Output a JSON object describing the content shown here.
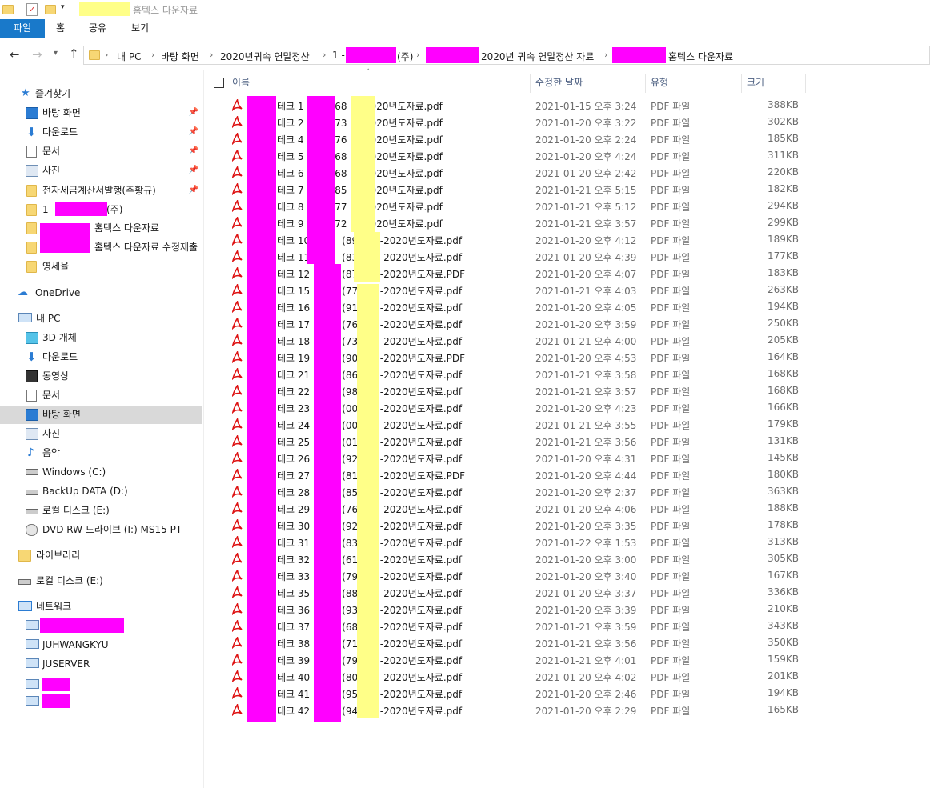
{
  "window": {
    "title": "홈텍스 다운자료"
  },
  "ribbon": {
    "tabs": [
      "파일",
      "홈",
      "공유",
      "보기"
    ]
  },
  "address": {
    "crumbs": [
      "내 PC",
      "바탕 화면",
      "2020년귀속 연말정산",
      "1 -",
      "(주)",
      "2020년 귀속 연말정산 자료",
      "홈텍스 다운자료"
    ]
  },
  "sidebar": {
    "quick_access": "즐겨찾기",
    "quick_items": [
      "바탕 화면",
      "다운로드",
      "문서",
      "사진",
      "전자세금계산서발행(주황규)",
      "1 -",
      "(주)",
      "홈텍스 다운자료",
      "홈텍스 다운자료 수정제출",
      "영세율"
    ],
    "onedrive": "OneDrive",
    "this_pc": "내 PC",
    "pc_items": [
      "3D 개체",
      "다운로드",
      "동영상",
      "문서",
      "바탕 화면",
      "사진",
      "음악",
      "Windows (C:)",
      "BackUp DATA (D:)",
      "로컬 디스크 (E:)",
      "DVD RW 드라이브 (I:) MS15 PT"
    ],
    "libraries": "라이브러리",
    "local_disk": "로컬 디스크 (E:)",
    "network": "네트워크",
    "network_items": [
      "JUHWANGKYU",
      "JUSERVER"
    ]
  },
  "columns": {
    "name": "이름",
    "date": "수정한 날짜",
    "type": "유형",
    "size": "크기"
  },
  "files": [
    {
      "n": "테크 1",
      "p": "(68",
      "s": "-2020년도자료.pdf",
      "d": "2021-01-15 오후 3:24",
      "t": "PDF 파일",
      "z": "388KB"
    },
    {
      "n": "테크 2",
      "p": "(73",
      "s": "-2020년도자료.pdf",
      "d": "2021-01-20 오후 3:22",
      "t": "PDF 파일",
      "z": "302KB"
    },
    {
      "n": "테크 4",
      "p": "(76",
      "s": "-2020년도자료.pdf",
      "d": "2021-01-20 오후 2:24",
      "t": "PDF 파일",
      "z": "185KB"
    },
    {
      "n": "테크 5",
      "p": "(68",
      "s": "-2020년도자료.pdf",
      "d": "2021-01-20 오후 4:24",
      "t": "PDF 파일",
      "z": "311KB"
    },
    {
      "n": "테크 6",
      "p": "(68",
      "s": "-2020년도자료.pdf",
      "d": "2021-01-20 오후 2:42",
      "t": "PDF 파일",
      "z": "220KB"
    },
    {
      "n": "테크 7",
      "p": "(85",
      "s": "-2020년도자료.pdf",
      "d": "2021-01-21 오후 5:15",
      "t": "PDF 파일",
      "z": "182KB"
    },
    {
      "n": "테크 8",
      "p": "(77",
      "s": "-2020년도자료.pdf",
      "d": "2021-01-21 오후 5:12",
      "t": "PDF 파일",
      "z": "294KB"
    },
    {
      "n": "테크 9",
      "p": "(72",
      "s": "-2020년도자료.pdf",
      "d": "2021-01-21 오후 3:57",
      "t": "PDF 파일",
      "z": "299KB"
    },
    {
      "n": "테크 10",
      "p": "(89",
      "s": ")-2020년도자료.pdf",
      "d": "2021-01-20 오후 4:12",
      "t": "PDF 파일",
      "z": "189KB"
    },
    {
      "n": "테크 11",
      "p": "(83",
      "s": ")-2020년도자료.pdf",
      "d": "2021-01-20 오후 4:39",
      "t": "PDF 파일",
      "z": "177KB"
    },
    {
      "n": "테크 12",
      "p": "(87",
      "s": ")-2020년도자료.PDF",
      "d": "2021-01-20 오후 4:07",
      "t": "PDF 파일",
      "z": "183KB"
    },
    {
      "n": "테크 15",
      "p": "(77",
      "s": ")-2020년도자료.pdf",
      "d": "2021-01-21 오후 4:03",
      "t": "PDF 파일",
      "z": "263KB"
    },
    {
      "n": "테크 16",
      "p": "(91",
      "s": ")-2020년도자료.pdf",
      "d": "2021-01-20 오후 4:05",
      "t": "PDF 파일",
      "z": "194KB"
    },
    {
      "n": "테크 17",
      "p": "(76",
      "s": ")-2020년도자료.pdf",
      "d": "2021-01-20 오후 3:59",
      "t": "PDF 파일",
      "z": "250KB"
    },
    {
      "n": "테크 18",
      "p": "(73",
      "s": ")-2020년도자료.pdf",
      "d": "2021-01-21 오후 4:00",
      "t": "PDF 파일",
      "z": "205KB"
    },
    {
      "n": "테크 19",
      "p": "(90",
      "s": ")-2020년도자료.PDF",
      "d": "2021-01-20 오후 4:53",
      "t": "PDF 파일",
      "z": "164KB"
    },
    {
      "n": "테크 21",
      "p": "(86",
      "s": ")-2020년도자료.pdf",
      "d": "2021-01-21 오후 3:58",
      "t": "PDF 파일",
      "z": "168KB"
    },
    {
      "n": "테크 22",
      "p": "(98",
      "s": ")-2020년도자료.pdf",
      "d": "2021-01-21 오후 3:57",
      "t": "PDF 파일",
      "z": "168KB"
    },
    {
      "n": "테크 23",
      "p": "(00",
      "s": ")-2020년도자료.pdf",
      "d": "2021-01-20 오후 4:23",
      "t": "PDF 파일",
      "z": "166KB"
    },
    {
      "n": "테크 24",
      "p": "(00",
      "s": ")-2020년도자료.pdf",
      "d": "2021-01-21 오후 3:55",
      "t": "PDF 파일",
      "z": "179KB"
    },
    {
      "n": "테크 25",
      "p": "(01",
      "s": ")-2020년도자료.pdf",
      "d": "2021-01-21 오후 3:56",
      "t": "PDF 파일",
      "z": "131KB"
    },
    {
      "n": "테크 26",
      "p": "(92",
      "s": ")-2020년도자료.pdf",
      "d": "2021-01-20 오후 4:31",
      "t": "PDF 파일",
      "z": "145KB"
    },
    {
      "n": "테크 27",
      "p": "(81",
      "s": ")-2020년도자료.PDF",
      "d": "2021-01-20 오후 4:44",
      "t": "PDF 파일",
      "z": "180KB"
    },
    {
      "n": "테크 28",
      "p": "(85",
      "s": ")-2020년도자료.pdf",
      "d": "2021-01-20 오후 2:37",
      "t": "PDF 파일",
      "z": "363KB"
    },
    {
      "n": "테크 29",
      "p": "(76",
      "s": ")-2020년도자료.pdf",
      "d": "2021-01-20 오후 4:06",
      "t": "PDF 파일",
      "z": "188KB"
    },
    {
      "n": "테크 30",
      "p": "(92",
      "s": ")-2020년도자료.pdf",
      "d": "2021-01-20 오후 3:35",
      "t": "PDF 파일",
      "z": "178KB"
    },
    {
      "n": "테크 31",
      "p": "(83",
      "s": ")-2020년도자료.pdf",
      "d": "2021-01-22 오후 1:53",
      "t": "PDF 파일",
      "z": "313KB"
    },
    {
      "n": "테크 32",
      "p": "(61",
      "s": ")-2020년도자료.pdf",
      "d": "2021-01-20 오후 3:00",
      "t": "PDF 파일",
      "z": "305KB"
    },
    {
      "n": "테크 33",
      "p": "(79",
      "s": ")-2020년도자료.pdf",
      "d": "2021-01-20 오후 3:40",
      "t": "PDF 파일",
      "z": "167KB"
    },
    {
      "n": "테크 35",
      "p": "(88",
      "s": ")-2020년도자료.pdf",
      "d": "2021-01-20 오후 3:37",
      "t": "PDF 파일",
      "z": "336KB"
    },
    {
      "n": "테크 36",
      "p": "(93",
      "s": ")-2020년도자료.pdf",
      "d": "2021-01-20 오후 3:39",
      "t": "PDF 파일",
      "z": "210KB"
    },
    {
      "n": "테크 37",
      "p": "(68",
      "s": ")-2020년도자료.pdf",
      "d": "2021-01-21 오후 3:59",
      "t": "PDF 파일",
      "z": "343KB"
    },
    {
      "n": "테크 38",
      "p": "(71",
      "s": ")-2020년도자료.pdf",
      "d": "2021-01-21 오후 3:56",
      "t": "PDF 파일",
      "z": "350KB"
    },
    {
      "n": "테크 39",
      "p": "(79",
      "s": ")-2020년도자료.pdf",
      "d": "2021-01-21 오후 4:01",
      "t": "PDF 파일",
      "z": "159KB"
    },
    {
      "n": "테크 40",
      "p": "(80",
      "s": ")-2020년도자료.pdf",
      "d": "2021-01-20 오후 4:02",
      "t": "PDF 파일",
      "z": "201KB"
    },
    {
      "n": "테크 41",
      "p": "(95",
      "s": ")-2020년도자료.pdf",
      "d": "2021-01-20 오후 2:46",
      "t": "PDF 파일",
      "z": "194KB"
    },
    {
      "n": "테크 42",
      "p": "(94",
      "s": ")-2020년도자료.pdf",
      "d": "2021-01-20 오후 2:29",
      "t": "PDF 파일",
      "z": "165KB"
    }
  ],
  "colors": {
    "accent": "#1979ca",
    "mask": "#ff00ff",
    "highlight": "#ffff88",
    "selected": "#d9d9d9"
  }
}
